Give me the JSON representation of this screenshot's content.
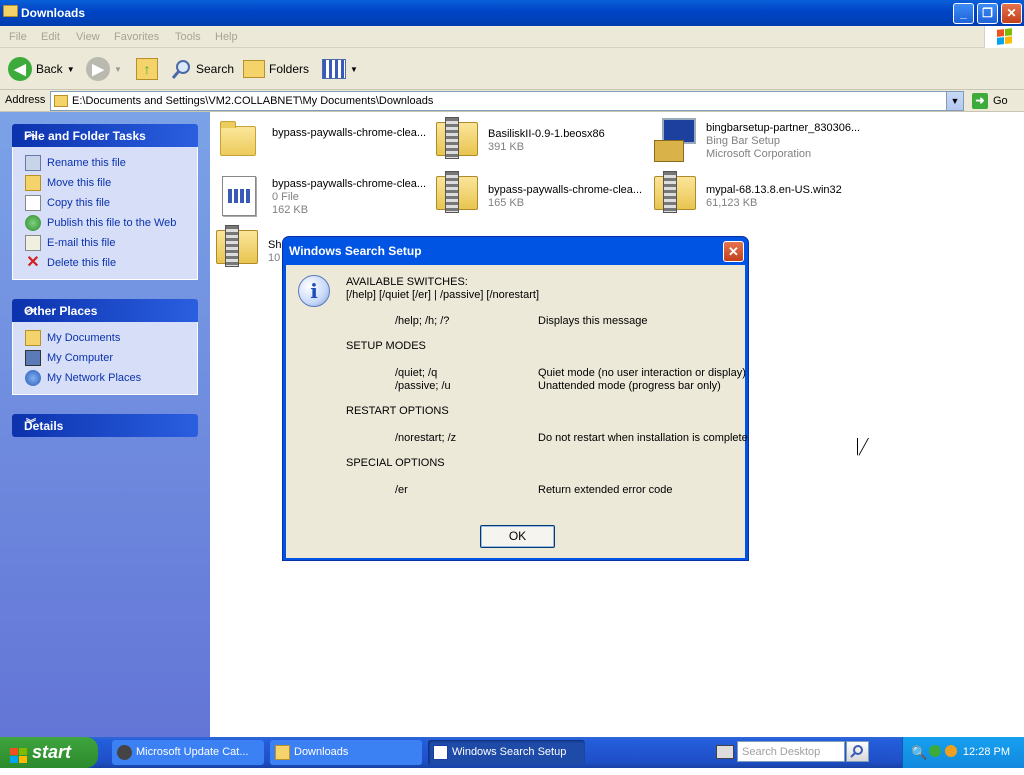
{
  "window": {
    "title": "Downloads"
  },
  "menubar": {
    "items": [
      "File",
      "Edit",
      "View",
      "Favorites",
      "Tools",
      "Help"
    ]
  },
  "toolbar": {
    "back": "Back",
    "search": "Search",
    "folders": "Folders"
  },
  "address": {
    "label": "Address",
    "path": "E:\\Documents and Settings\\VM2.COLLABNET\\My Documents\\Downloads",
    "go": "Go"
  },
  "sidebar": {
    "file_tasks": {
      "title": "File and Folder Tasks",
      "items": [
        "Rename this file",
        "Move this file",
        "Copy this file",
        "Publish this file to the Web",
        "E-mail this file",
        "Delete this file"
      ]
    },
    "other_places": {
      "title": "Other Places",
      "items": [
        "My Documents",
        "My Computer",
        "My Network Places"
      ]
    },
    "details": {
      "title": "Details"
    }
  },
  "files": [
    {
      "name": "bypass-paywalls-chrome-clea...",
      "line2": "",
      "line3": ""
    },
    {
      "name": "BasiliskII-0.9-1.beosx86",
      "line2": "391 KB",
      "line3": ""
    },
    {
      "name": "bingbarsetup-partner_830306...",
      "line2": "Bing Bar Setup",
      "line3": "Microsoft Corporation"
    },
    {
      "name": "bypass-paywalls-chrome-clea...",
      "line2": "0 File",
      "line3": "162 KB"
    },
    {
      "name": "bypass-paywalls-chrome-clea...",
      "line2": "165 KB",
      "line3": ""
    },
    {
      "name": "mypal-68.13.8.en-US.win32",
      "line2": "61,123 KB",
      "line3": ""
    },
    {
      "name": "Sh",
      "line2": "10",
      "line3": ""
    }
  ],
  "dialog": {
    "title": "Windows Search Setup",
    "heading": "AVAILABLE SWITCHES:",
    "syntax": "[/help] [/quiet [/er] | /passive] [/norestart]",
    "help_switch": "/help; /h; /?",
    "help_desc": "Displays this message",
    "setup_modes": "SETUP MODES",
    "quiet_switch": "/quiet; /q",
    "quiet_desc": "Quiet mode (no user interaction or display)",
    "passive_switch": "/passive; /u",
    "passive_desc": "Unattended mode (progress bar only)",
    "restart_options": "RESTART OPTIONS",
    "norestart_switch": "/norestart; /z",
    "norestart_desc": "Do not restart when installation is complete",
    "special_options": "SPECIAL OPTIONS",
    "er_switch": "/er",
    "er_desc": "Return extended error code",
    "ok": "OK"
  },
  "taskbar": {
    "start": "start",
    "tasks": [
      "Microsoft Update Cat...",
      "Downloads",
      "Windows Search Setup"
    ],
    "search_placeholder": "Search Desktop",
    "clock": "12:28 PM"
  }
}
